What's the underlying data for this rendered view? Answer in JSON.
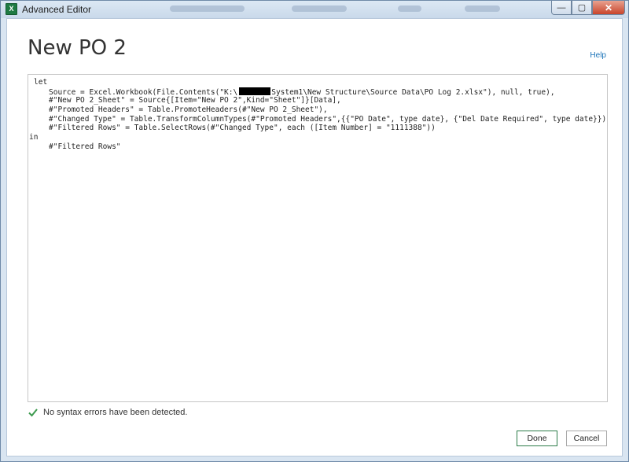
{
  "window": {
    "title": "Advanced Editor",
    "app_icon_glyph": "X",
    "controls": {
      "minimize_icon": "minimize-icon",
      "maximize_icon": "maximize-icon",
      "close_icon": "close-icon",
      "minimize_glyph": "—",
      "maximize_glyph": "▢",
      "close_glyph": "✕"
    }
  },
  "header": {
    "title": "New PO 2",
    "help_label": "Help"
  },
  "editor": {
    "lines": [
      "let",
      "Source = Excel.Workbook(File.Contents(\"K:\\",
      "System1\\New Structure\\Source Data\\PO Log 2.xlsx\"), null, true),",
      "#\"New PO 2_Sheet\" = Source{[Item=\"New PO 2\",Kind=\"Sheet\"]}[Data],",
      "#\"Promoted Headers\" = Table.PromoteHeaders(#\"New PO 2_Sheet\"),",
      "#\"Changed Type\" = Table.TransformColumnTypes(#\"Promoted Headers\",{{\"PO Date\", type date}, {\"Del Date Required\", type date}}),",
      "#\"Filtered Rows\" = Table.SelectRows(#\"Changed Type\", each ([Item Number] = \"1111388\"))",
      "in",
      "#\"Filtered Rows\""
    ]
  },
  "status": {
    "icon": "checkmark-icon",
    "text": "No syntax errors have been detected."
  },
  "buttons": {
    "done": "Done",
    "cancel": "Cancel"
  },
  "colors": {
    "accent": "#1a73b8",
    "check": "#3c9a4e",
    "done_border": "#2d7d4a"
  }
}
